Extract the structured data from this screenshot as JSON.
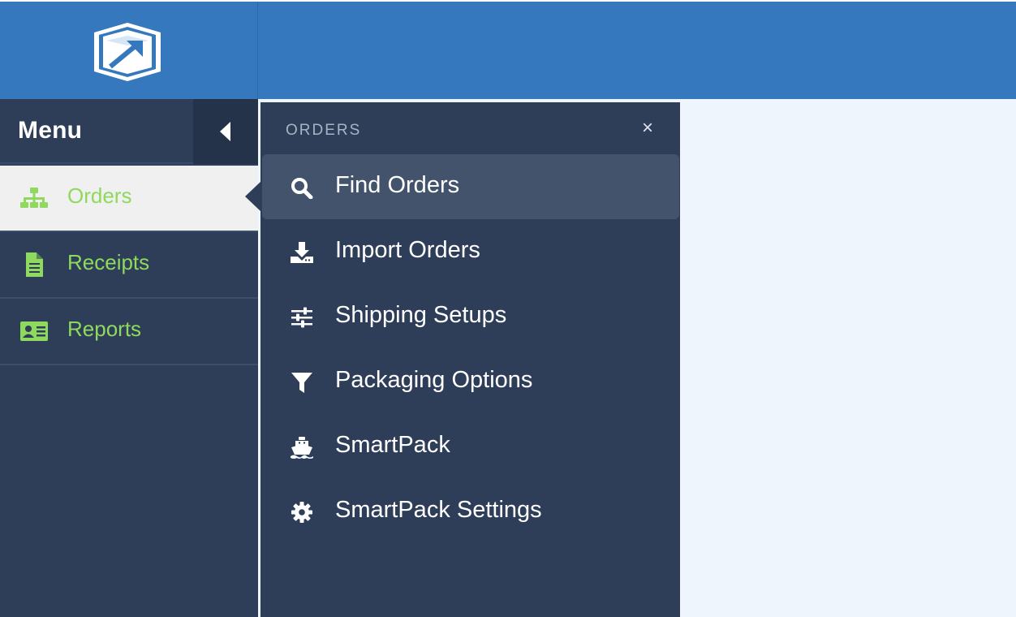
{
  "brand": {
    "logo_icon": "box-arrow-logo"
  },
  "sidebar": {
    "title": "Menu",
    "toggle_icon": "caret-left-icon",
    "items": [
      {
        "label": "Orders",
        "icon": "sitemap-icon",
        "active": true
      },
      {
        "label": "Receipts",
        "icon": "document-icon",
        "active": false
      },
      {
        "label": "Reports",
        "icon": "id-card-icon",
        "active": false
      }
    ]
  },
  "flyout": {
    "title": "ORDERS",
    "close_label": "×",
    "items": [
      {
        "label": "Find Orders",
        "icon": "search-icon",
        "highlighted": true
      },
      {
        "label": "Import Orders",
        "icon": "download-icon",
        "highlighted": false
      },
      {
        "label": "Shipping Setups",
        "icon": "sliders-icon",
        "highlighted": false
      },
      {
        "label": "Packaging Options",
        "icon": "filter-icon",
        "highlighted": false
      },
      {
        "label": "SmartPack",
        "icon": "ship-icon",
        "highlighted": false
      },
      {
        "label": "SmartPack Settings",
        "icon": "gear-icon",
        "highlighted": false
      }
    ]
  },
  "colors": {
    "header_blue": "#3578bd",
    "sidebar_navy": "#2e3e58",
    "menu_green": "#8ed95e",
    "highlight": "#44536c",
    "content_bg": "#eef5fd"
  }
}
